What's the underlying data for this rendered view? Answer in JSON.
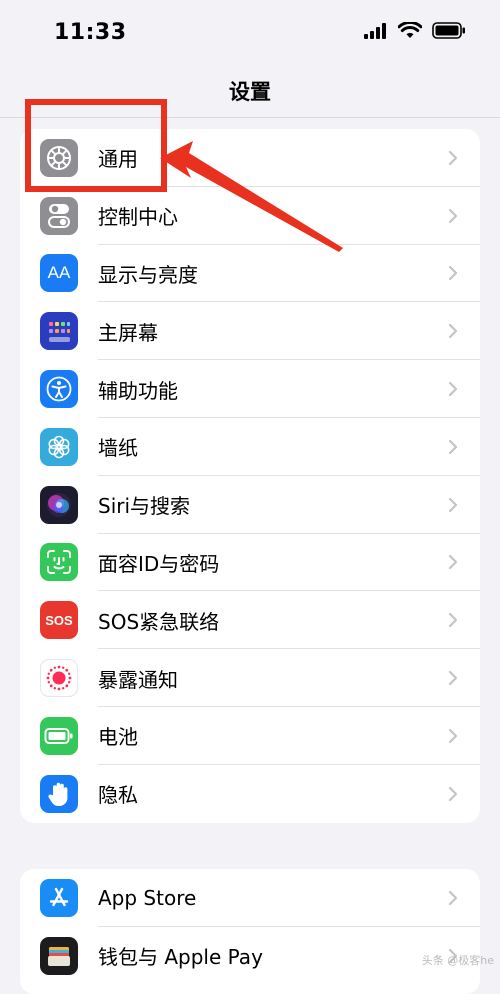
{
  "status_bar": {
    "time": "11:33",
    "icons": [
      "signal-icon",
      "wifi-icon",
      "battery-icon"
    ]
  },
  "nav": {
    "title": "设置"
  },
  "groups": [
    {
      "items": [
        {
          "label": "通用",
          "icon": "gear-icon",
          "color": "#8e8e93"
        },
        {
          "label": "控制中心",
          "icon": "toggle-icon",
          "color": "#8e8e93"
        },
        {
          "label": "显示与亮度",
          "icon": "aa-icon",
          "color": "#1a7cf5"
        },
        {
          "label": "主屏幕",
          "icon": "home-grid-icon",
          "color": "#2b3dbf"
        },
        {
          "label": "辅助功能",
          "icon": "accessibility-icon",
          "color": "#1a7cf5"
        },
        {
          "label": "墙纸",
          "icon": "flower-icon",
          "color": "#35aadc"
        },
        {
          "label": "Siri与搜索",
          "icon": "siri-icon",
          "color": "#1c1c2e"
        },
        {
          "label": "面容ID与密码",
          "icon": "face-id-icon",
          "color": "#34c759"
        },
        {
          "label": "SOS紧急联络",
          "icon": "sos-icon",
          "color": "#e8372c"
        },
        {
          "label": "暴露通知",
          "icon": "exposure-icon",
          "color": "#ffffff"
        },
        {
          "label": "电池",
          "icon": "battery-icon",
          "color": "#34c759"
        },
        {
          "label": "隐私",
          "icon": "hand-icon",
          "color": "#1a7cf5"
        }
      ]
    },
    {
      "items": [
        {
          "label": "App Store",
          "icon": "app-store-icon",
          "color": "#1a8cf5"
        },
        {
          "label": "钱包与 Apple Pay",
          "icon": "wallet-icon",
          "color": "#1c1c1e"
        }
      ]
    }
  ],
  "sos_icon_text": "SOS",
  "aa_icon_text": "AA",
  "watermark": "头条 @极客he",
  "annotation_color": "#e8311f"
}
